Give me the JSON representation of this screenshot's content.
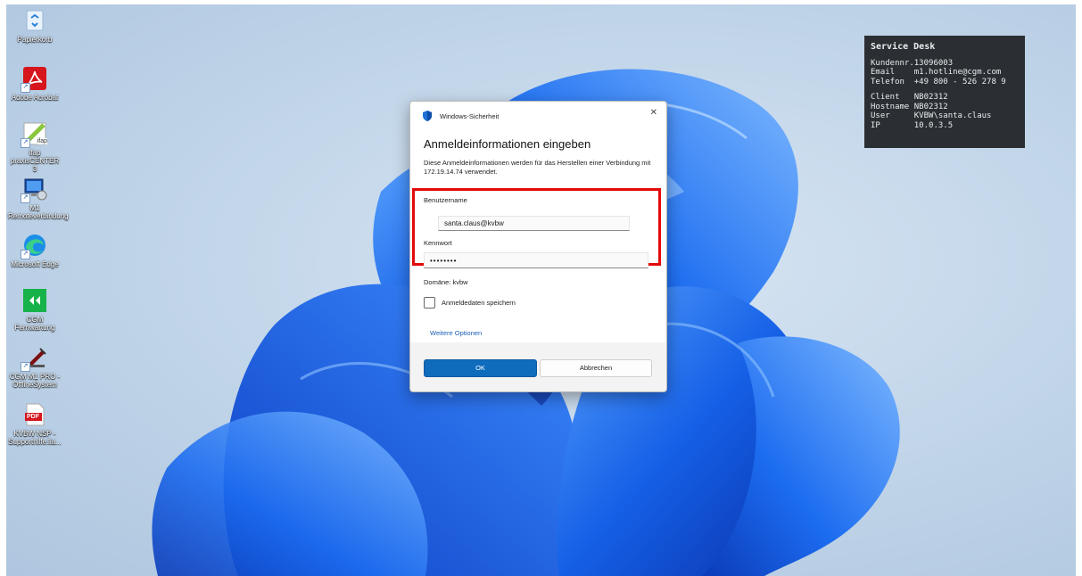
{
  "desktop_icons": [
    {
      "label": "Papierkorb",
      "icon": "recycle-bin-icon"
    },
    {
      "label": "Adobe Acrobat",
      "icon": "acrobat-icon"
    },
    {
      "label": "ifap praxisCENTER 3",
      "icon": "ifap-icon",
      "badge": "ifap"
    },
    {
      "label": "M1\nRemoteverbindung",
      "icon": "remote-connection-icon"
    },
    {
      "label": "Microsoft Edge",
      "icon": "edge-icon"
    },
    {
      "label": "CGM Fernwartung",
      "icon": "cgm-remote-icon"
    },
    {
      "label": "CGM M1 PRO -\nOfflineSystem",
      "icon": "cgm-m1-pro-icon"
    },
    {
      "label": "KVBW NSP -\nSupporthilfe.lia...",
      "icon": "pdf-file-icon",
      "badge": "PDF"
    }
  ],
  "service_desk": {
    "title": "Service Desk",
    "lines1": [
      "Kundennr.13096003",
      "Email    m1.hotline@cgm.com",
      "Telefon  +49 800 - 526 278 9"
    ],
    "lines2": [
      "Client   NB02312",
      "Hostname NB02312",
      "User     KVBW\\santa.claus",
      "IP       10.0.3.5"
    ]
  },
  "dialog": {
    "app_title": "Windows-Sicherheit",
    "close_glyph": "✕",
    "heading": "Anmeldeinformationen eingeben",
    "description": "Diese Anmeldeinformationen werden für das Herstellen einer Verbindung mit 172.19.14.74 verwendet.",
    "username_label": "Benutzername",
    "username_value": "santa.claus@kvbw",
    "password_label": "Kennwort",
    "password_value": "••••••••",
    "domain_text": "Domäne: kvbw",
    "remember_label": "Anmeldedaten speichern",
    "more_options": "Weitere Optionen",
    "ok_label": "OK",
    "cancel_label": "Abbrechen",
    "accent_color": "#0f6cbd",
    "highlight_color": "#e20a0a"
  }
}
